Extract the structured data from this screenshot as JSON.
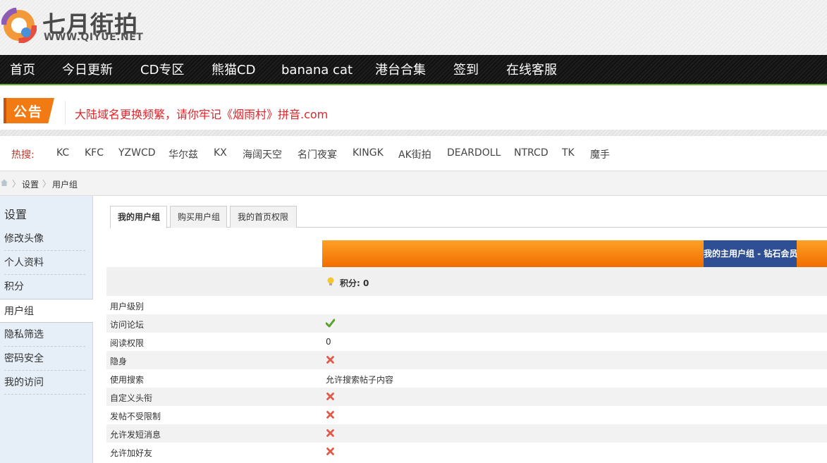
{
  "logo": {
    "title": "七月街拍",
    "url": "WWW.QIYUE.NET"
  },
  "nav": {
    "items": [
      "首页",
      "今日更新",
      "CD专区",
      "熊猫CD",
      "banana cat",
      "港台合集",
      "签到",
      "在线客服"
    ]
  },
  "notice": {
    "badge": "公告",
    "message": "大陆域名更换频繁，请你牢记《烟雨村》拼音.com"
  },
  "hot": {
    "label": "热搜:",
    "tags": [
      "KC",
      "KFC",
      "YZWCD",
      "华尔兹",
      "KX",
      "海阔天空",
      "名门夜宴",
      "KINGK",
      "AK街拍",
      "DEARDOLL",
      "NTRCD",
      "TK",
      "魔手"
    ]
  },
  "breadcrumb": {
    "items": [
      "设置",
      "用户组"
    ]
  },
  "sidebar": {
    "heading": "设置",
    "items": [
      "修改头像",
      "个人资料",
      "积分",
      "用户组",
      "隐私筛选",
      "密码安全",
      "我的访问"
    ],
    "active": "用户组"
  },
  "tabs": {
    "items": [
      "我的用户组",
      "购买用户组",
      "我的首页权限"
    ],
    "active": "我的用户组"
  },
  "group": {
    "name": "我的主用户组 - 钻石会员",
    "score": "积分: 0"
  },
  "permissions": [
    {
      "key": "用户级别",
      "value": ""
    },
    {
      "key": "访问论坛",
      "value": "",
      "icon": "check-icon"
    },
    {
      "key": "阅读权限",
      "value": "0"
    },
    {
      "key": "隐身",
      "value": "",
      "icon": "cross-icon"
    },
    {
      "key": "使用搜索",
      "value": "允许搜索帖子内容"
    },
    {
      "key": "自定义头衔",
      "value": "",
      "icon": "cross-icon"
    },
    {
      "key": "发帖不受限制",
      "value": "",
      "icon": "cross-icon"
    },
    {
      "key": "允许发短消息",
      "value": "",
      "icon": "cross-icon"
    },
    {
      "key": "允许加好友",
      "value": "",
      "icon": "cross-icon"
    }
  ],
  "colors": {
    "accent": "#f27a12",
    "nav_bg": "#111111",
    "group_bg": "#2f4f95",
    "notice_text": "#e0242b",
    "check": "#5aa02c",
    "cross": "#e05a4a"
  }
}
